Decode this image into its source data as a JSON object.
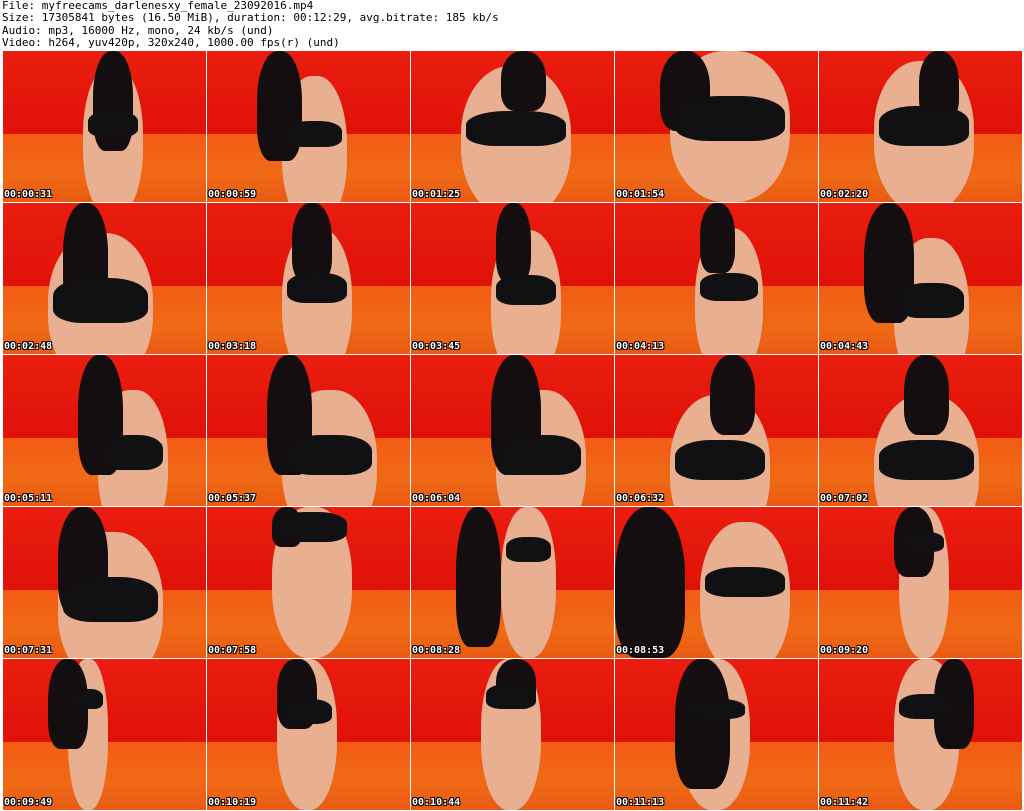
{
  "header": {
    "file_line": "File: myfreecams_darlenesxy_female_23092016.mp4",
    "size_line": "Size: 17305841 bytes (16.50 MiB), duration: 00:12:29, avg.bitrate: 185 kb/s",
    "audio_line": "Audio: mp3, 16000 Hz, mono, 24 kb/s (und)",
    "video_line": "Video: h264, yuv420p, 320x240, 1000.00 fps(r) (und)"
  },
  "thumbnails": [
    {
      "time": "00:00:31"
    },
    {
      "time": "00:00:59"
    },
    {
      "time": "00:01:25"
    },
    {
      "time": "00:01:54"
    },
    {
      "time": "00:02:20"
    },
    {
      "time": "00:02:48"
    },
    {
      "time": "00:03:18"
    },
    {
      "time": "00:03:45"
    },
    {
      "time": "00:04:13"
    },
    {
      "time": "00:04:43"
    },
    {
      "time": "00:05:11"
    },
    {
      "time": "00:05:37"
    },
    {
      "time": "00:06:04"
    },
    {
      "time": "00:06:32"
    },
    {
      "time": "00:07:02"
    },
    {
      "time": "00:07:31"
    },
    {
      "time": "00:07:58"
    },
    {
      "time": "00:08:28"
    },
    {
      "time": "00:08:53"
    },
    {
      "time": "00:09:20"
    },
    {
      "time": "00:09:49"
    },
    {
      "time": "00:10:19"
    },
    {
      "time": "00:10:44"
    },
    {
      "time": "00:11:13"
    },
    {
      "time": "00:11:42"
    }
  ]
}
